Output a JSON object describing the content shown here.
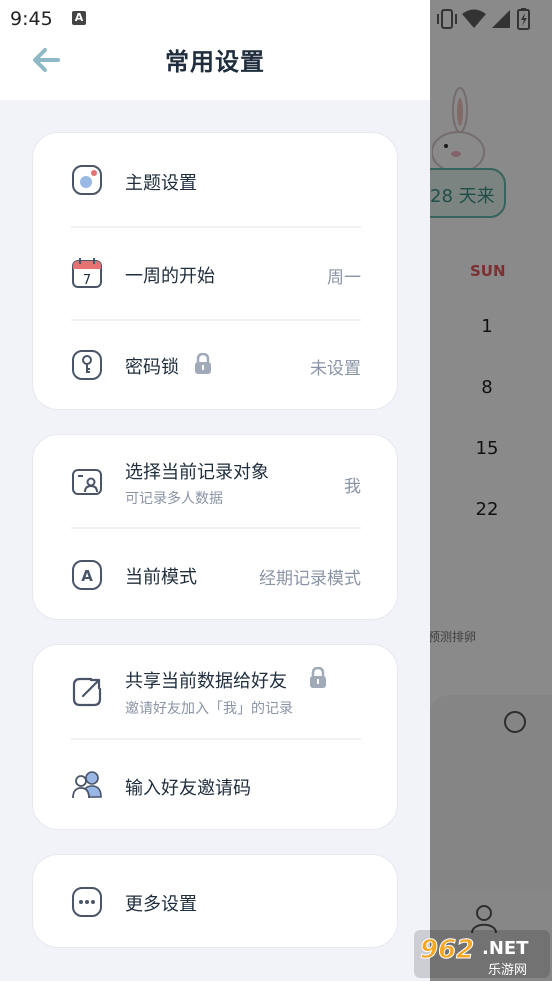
{
  "status_bar": {
    "time": "9:45"
  },
  "header": {
    "title": "常用设置"
  },
  "cards": [
    {
      "rows": [
        {
          "icon": "theme-icon",
          "label": "主题设置",
          "value": ""
        },
        {
          "icon": "calendar-icon",
          "label": "一周的开始",
          "value": "周一",
          "calendar_day": "7"
        },
        {
          "icon": "lock-key-icon",
          "label": "密码锁",
          "value": "未设置"
        }
      ]
    },
    {
      "rows": [
        {
          "icon": "profile-card-icon",
          "label": "选择当前记录对象",
          "sub": "可记录多人数据",
          "value": "我"
        },
        {
          "icon": "mode-a-icon",
          "label": "当前模式",
          "value": "经期记录模式",
          "icon_letter": "A"
        }
      ]
    },
    {
      "rows": [
        {
          "icon": "share-icon",
          "label": "共享当前数据给好友",
          "sub": "邀请好友加入「我」的记录"
        },
        {
          "icon": "friends-icon",
          "label": "输入好友邀请码"
        }
      ]
    },
    {
      "rows": [
        {
          "icon": "more-icon",
          "label": "更多设置"
        }
      ]
    }
  ],
  "background": {
    "pill_text": "28 天来",
    "weekday": "SUN",
    "dates": [
      "1",
      "8",
      "15",
      "22"
    ],
    "note": "预测排卵"
  },
  "watermark": {
    "brand": "962.NET",
    "sub": "乐游网"
  },
  "colors": {
    "drawer_bg": "#f1f3f8",
    "accent_teal": "#64b7a8",
    "text_primary": "#1f2d3d",
    "text_secondary": "#8a94a6",
    "icon_stroke": "#4a5568",
    "sunday_red": "#e05b5b"
  }
}
